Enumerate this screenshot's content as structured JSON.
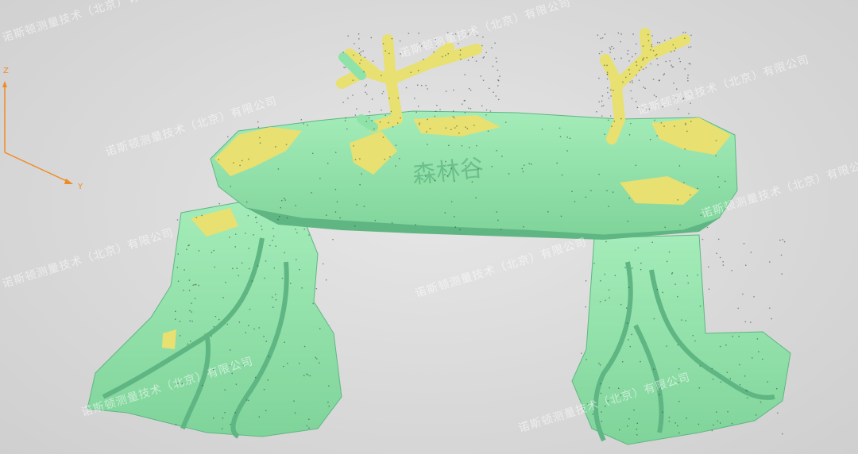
{
  "viewport": {
    "background": "#dcdcdc"
  },
  "axes": {
    "color": "#f08a24",
    "z_label": "Z",
    "y_label": "Y"
  },
  "model": {
    "colors": {
      "green": "#8fe3a8",
      "green_shadow": "#5fb683",
      "yellow": "#e8e070",
      "points": "#2c3a2f"
    },
    "inscription": "森林谷"
  },
  "watermark": {
    "text": "诺斯顿测量技术（北京）有限公司"
  }
}
